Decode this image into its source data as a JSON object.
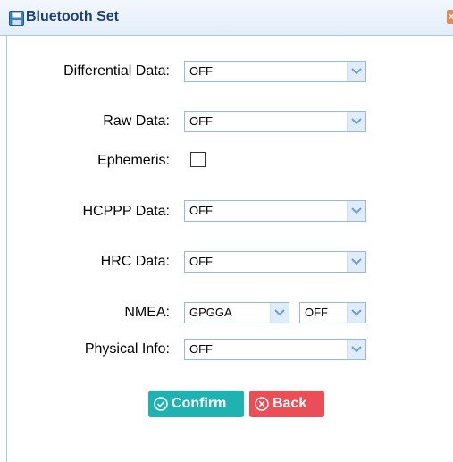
{
  "dialog": {
    "title": "Bluetooth Set",
    "close_icon": "close-icon",
    "title_icon": "floppy-disk-icon"
  },
  "fields": {
    "differential_data": {
      "label": "Differential Data:",
      "value": "OFF"
    },
    "raw_data": {
      "label": "Raw Data:",
      "value": "OFF"
    },
    "ephemeris": {
      "label": "Ephemeris:",
      "checked": false
    },
    "hcppp_data": {
      "label": "HCPPP Data:",
      "value": "OFF"
    },
    "hrc_data": {
      "label": "HRC Data:",
      "value": "OFF"
    },
    "nmea": {
      "label": "NMEA:",
      "type_value": "GPGGA",
      "rate_value": "OFF"
    },
    "physical_info": {
      "label": "Physical Info:",
      "value": "OFF"
    }
  },
  "buttons": {
    "confirm_label": "Confirm",
    "back_label": "Back"
  },
  "colors": {
    "confirm": "#20b2b0",
    "back": "#ea4e56",
    "title_text": "#1a3f7a",
    "select_border": "#95b8e7"
  }
}
